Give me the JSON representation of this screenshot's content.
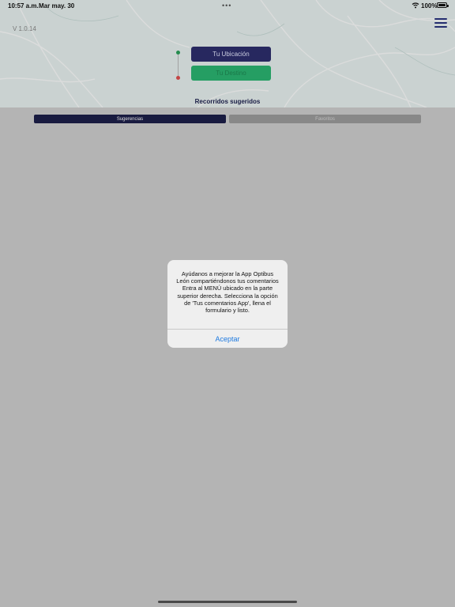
{
  "status_bar": {
    "time": "10:57 a.m.",
    "date": "Mar may. 30",
    "multitask_dots": "•••",
    "battery_percent": "100%"
  },
  "app": {
    "version": "V 1.0.14"
  },
  "route": {
    "origin_label": "Tu Ubicación",
    "destination_label": "Tu Destino",
    "origin_dot_color": "#2aa05a",
    "destination_dot_color": "#e05050"
  },
  "suggested": {
    "title": "Recorridos sugeridos",
    "tabs": [
      {
        "label": "Sugerencias",
        "active": true
      },
      {
        "label": "Favoritos",
        "active": false
      }
    ]
  },
  "alert": {
    "message": "Ayúdanos a mejorar la App Optibus León compartiéndonos tus comentarios Entra al MENÚ   ubicado en la parte superior derecha. Selecciona la opción de 'Tus comentarios App', llena el formulario y listo.",
    "button_label": "Aceptar"
  },
  "colors": {
    "accent_navy": "#2d2f6e",
    "accent_green": "#2bb672",
    "alert_button": "#1e7ae0"
  }
}
